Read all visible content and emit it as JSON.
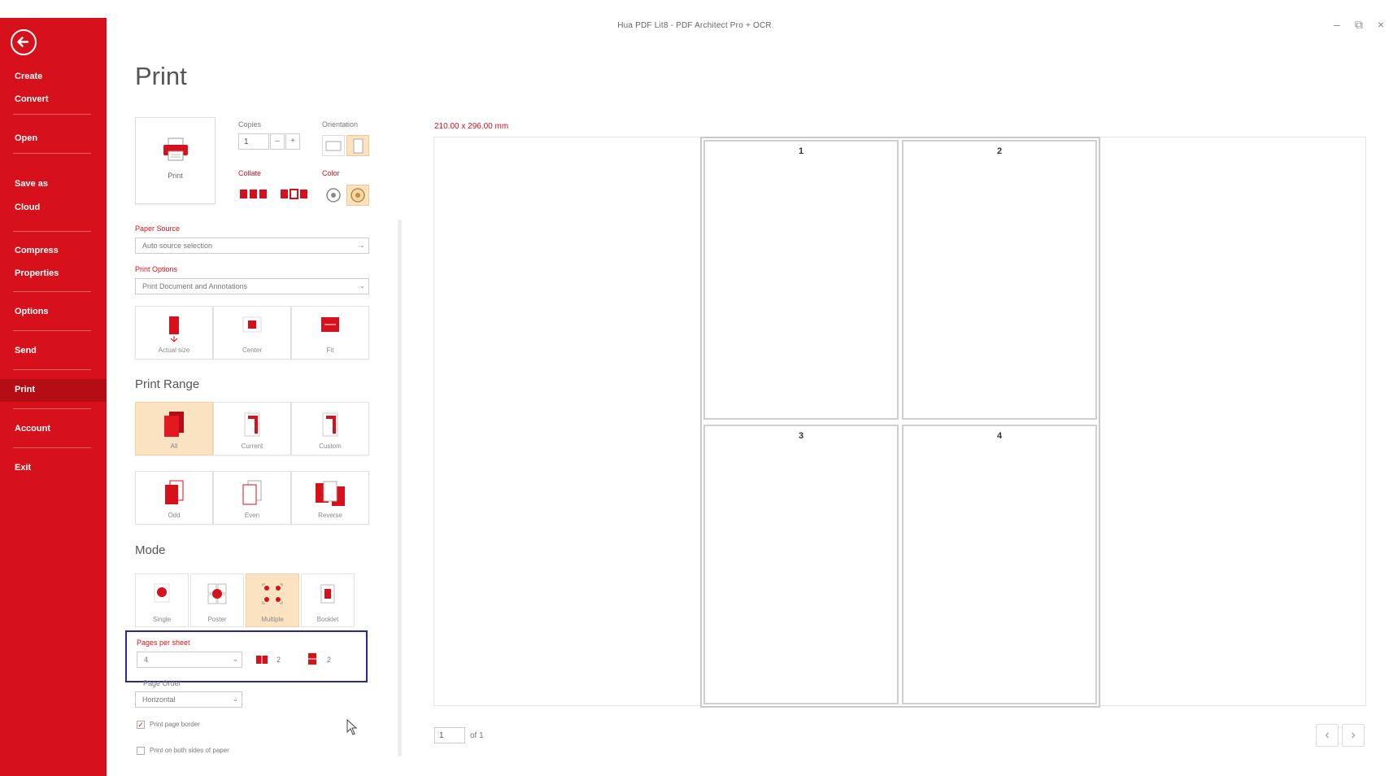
{
  "window": {
    "title": "Hua PDF Lit8 - PDF Architect Pro + OCR"
  },
  "sidebar": {
    "items": [
      {
        "label": "Create"
      },
      {
        "label": "Convert"
      },
      {
        "label": "Open"
      },
      {
        "label": "Save as"
      },
      {
        "label": "Cloud"
      },
      {
        "label": "Compress"
      },
      {
        "label": "Properties"
      },
      {
        "label": "Options"
      },
      {
        "label": "Send"
      },
      {
        "label": "Print"
      },
      {
        "label": "Account"
      },
      {
        "label": "Exit"
      }
    ],
    "active": "Print"
  },
  "page": {
    "title": "Print"
  },
  "print_panel": {
    "print_button_label": "Print",
    "copies_label": "Copies",
    "copies_value": "1",
    "orientation_label": "Orientation",
    "collate_label": "Collate",
    "color_label": "Color",
    "paper_source_label": "Paper Source",
    "paper_source_value": "Auto source selection",
    "print_options_label": "Print Options",
    "print_options_value": "Print Document and Annotations",
    "scaling_tiles": [
      {
        "label": "Actual size"
      },
      {
        "label": "Center"
      },
      {
        "label": "Fit"
      }
    ],
    "print_range_title": "Print Range",
    "range_tiles_row1": [
      {
        "label": "All",
        "selected": true
      },
      {
        "label": "Current",
        "selected": false
      },
      {
        "label": "Custom",
        "selected": false
      }
    ],
    "range_tiles_row2": [
      {
        "label": "Odd"
      },
      {
        "label": "Even"
      },
      {
        "label": "Reverse"
      }
    ],
    "mode_title": "Mode",
    "mode_tiles": [
      {
        "label": "Single",
        "selected": false
      },
      {
        "label": "Poster",
        "selected": false
      },
      {
        "label": "Multiple",
        "selected": true
      },
      {
        "label": "Booklet",
        "selected": false
      }
    ],
    "pages_per_sheet_label": "Pages per sheet",
    "pages_per_sheet_value": "4",
    "cols_value": "2",
    "rows_value": "2",
    "page_order_label": "Page Order",
    "page_order_value": "Horizontal",
    "checkbox_print_border": "Print page border",
    "checkbox_print_both": "Print on both sides of paper"
  },
  "preview": {
    "paper_size": "210.00 x 296.00 mm",
    "pages": [
      "1",
      "2",
      "3",
      "4"
    ],
    "current_page": "1",
    "page_of": "of 1"
  },
  "colors": {
    "brand_red": "#d6111b",
    "highlight_blue": "#2b2a8a",
    "selected_tile": "#fbe3c2"
  }
}
